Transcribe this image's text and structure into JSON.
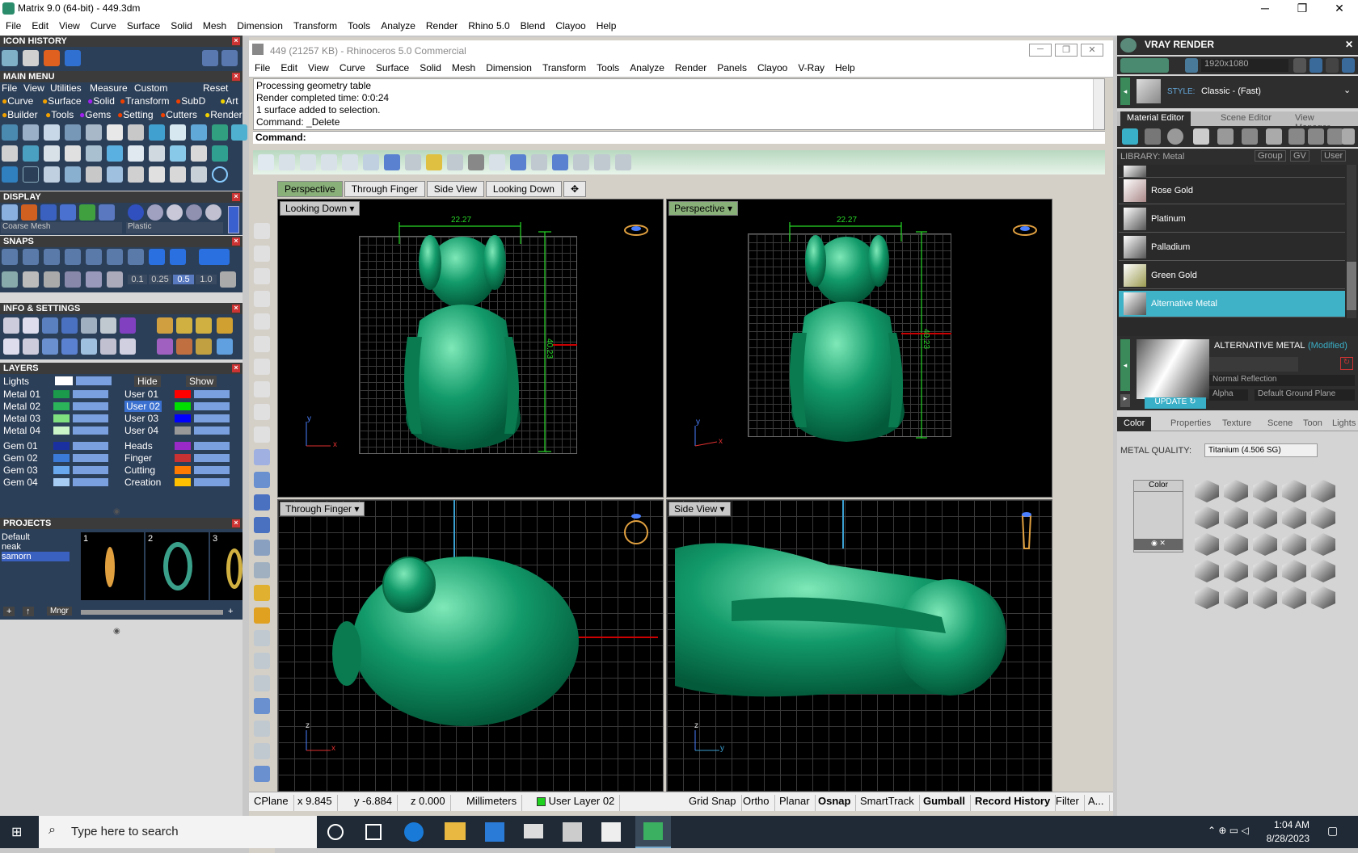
{
  "window": {
    "title": "Matrix 9.0 (64-bit) - 449.3dm",
    "min": "─",
    "max": "❐",
    "close": "✕"
  },
  "menubar": [
    "File",
    "Edit",
    "View",
    "Curve",
    "Surface",
    "Solid",
    "Mesh",
    "Dimension",
    "Transform",
    "Tools",
    "Analyze",
    "Render",
    "Rhino 5.0",
    "Blend",
    "Clayoo",
    "Help"
  ],
  "left": {
    "icon_history": "ICON HISTORY",
    "main_menu": "MAIN MENU",
    "mm_row1": [
      "File",
      "View",
      "Utilities",
      "Measure",
      "Custom",
      "Reset"
    ],
    "mm_row2": [
      "Curve",
      "Surface",
      "Solid",
      "Transform",
      "SubD",
      "Art"
    ],
    "mm_row3": [
      "Builder",
      "Tools",
      "Gems",
      "Setting",
      "Cutters",
      "Render"
    ],
    "display": "DISPLAY",
    "display_mesh": "Coarse Mesh",
    "display_material": "Plastic",
    "snaps": "SNAPS",
    "snap_vals": [
      "0.1",
      "0.25",
      "0.5",
      "1.0"
    ],
    "info": "INFO & SETTINGS",
    "layers": "LAYERS",
    "lights": "Lights",
    "hide": "Hide",
    "show": "Show",
    "layers_left": [
      {
        "n": "Metal 01",
        "c": "#1a9a4a"
      },
      {
        "n": "Metal 02",
        "c": "#2bb45a"
      },
      {
        "n": "Metal 03",
        "c": "#7fe07f"
      },
      {
        "n": "Metal 04",
        "c": "#c9f5c9"
      }
    ],
    "layers_right": [
      {
        "n": "User 01",
        "c": "#ff0000"
      },
      {
        "n": "User 02",
        "c": "#00dd00"
      },
      {
        "n": "User 03",
        "c": "#0000ff"
      },
      {
        "n": "User 04",
        "c": "#999999"
      }
    ],
    "gems_left": [
      {
        "n": "Gem 01",
        "c": "#1a2fa0"
      },
      {
        "n": "Gem 02",
        "c": "#3c7ad8"
      },
      {
        "n": "Gem 03",
        "c": "#6aa8ee"
      },
      {
        "n": "Gem 04",
        "c": "#a8cdf5"
      }
    ],
    "gems_right": [
      {
        "n": "Heads",
        "c": "#9a2ac8"
      },
      {
        "n": "Finger",
        "c": "#c83232"
      },
      {
        "n": "Cutting",
        "c": "#ff7a00"
      },
      {
        "n": "Creation",
        "c": "#ffc000"
      }
    ],
    "projects": "PROJECTS",
    "project_list": [
      "Default",
      "neak",
      "samorn"
    ],
    "thumbs": [
      "1",
      "2",
      "3"
    ],
    "mngr": "Mngr"
  },
  "rhino": {
    "title": "449 (21257 KB) - Rhinoceros 5.0 Commercial",
    "menu": [
      "File",
      "Edit",
      "View",
      "Curve",
      "Surface",
      "Solid",
      "Mesh",
      "Dimension",
      "Transform",
      "Tools",
      "Analyze",
      "Render",
      "Panels",
      "Clayoo",
      "V-Ray",
      "Help"
    ],
    "history": [
      "Processing geometry table",
      "Render completed time: 0:0:24",
      "1 surface added to selection.",
      "Command: _Delete"
    ],
    "command_label": "Command:",
    "tabs": [
      "Perspective",
      "Through Finger",
      "Side View",
      "Looking Down",
      "✥"
    ],
    "vp1": "Looking Down",
    "vp2": "Perspective",
    "vp3": "Through Finger",
    "vp4": "Side View",
    "dim_w": "22.27",
    "dim_h": "40.23",
    "axis_x": "x",
    "axis_y": "y",
    "axis_z": "z"
  },
  "status": [
    "CPlane",
    "x 9.845",
    "y -6.884",
    "z 0.000",
    "Millimeters",
    "User Layer 02",
    "Grid Snap",
    "Ortho",
    "Planar",
    "Osnap",
    "SmartTrack",
    "Gumball",
    "Record History",
    "Filter",
    "A..."
  ],
  "status_layer_color": "#1fd01f",
  "right": {
    "title": "VRAY RENDER",
    "resolution": "1920x1080",
    "style_label": "STYLE:",
    "style_value": "Classic - (Fast)",
    "tabs": [
      "Material Editor",
      "Scene Editor",
      "View Manager"
    ],
    "library": "LIBRARY: Metal",
    "group": "Group",
    "gv": "GV",
    "user": "User",
    "materials": [
      "Rose Gold",
      "Platinum",
      "Palladium",
      "Green Gold",
      "Alternative Metal"
    ],
    "selected_title": "ALTERNATIVE METAL",
    "modified": "(Modified)",
    "reflection": "Normal Reflection",
    "alpha": "Alpha",
    "ground": "Default Ground Plane",
    "update": "UPDATE",
    "subtabs": [
      "Color",
      "Properties",
      "Texture",
      "Scene",
      "Toon",
      "Lights"
    ],
    "quality_label": "METAL QUALITY:",
    "quality_value": "Titanium   (4.506 SG)",
    "color_label": "Color"
  },
  "taskbar": {
    "search": "Type here to search",
    "time": "1:04 AM",
    "date": "8/28/2023"
  }
}
